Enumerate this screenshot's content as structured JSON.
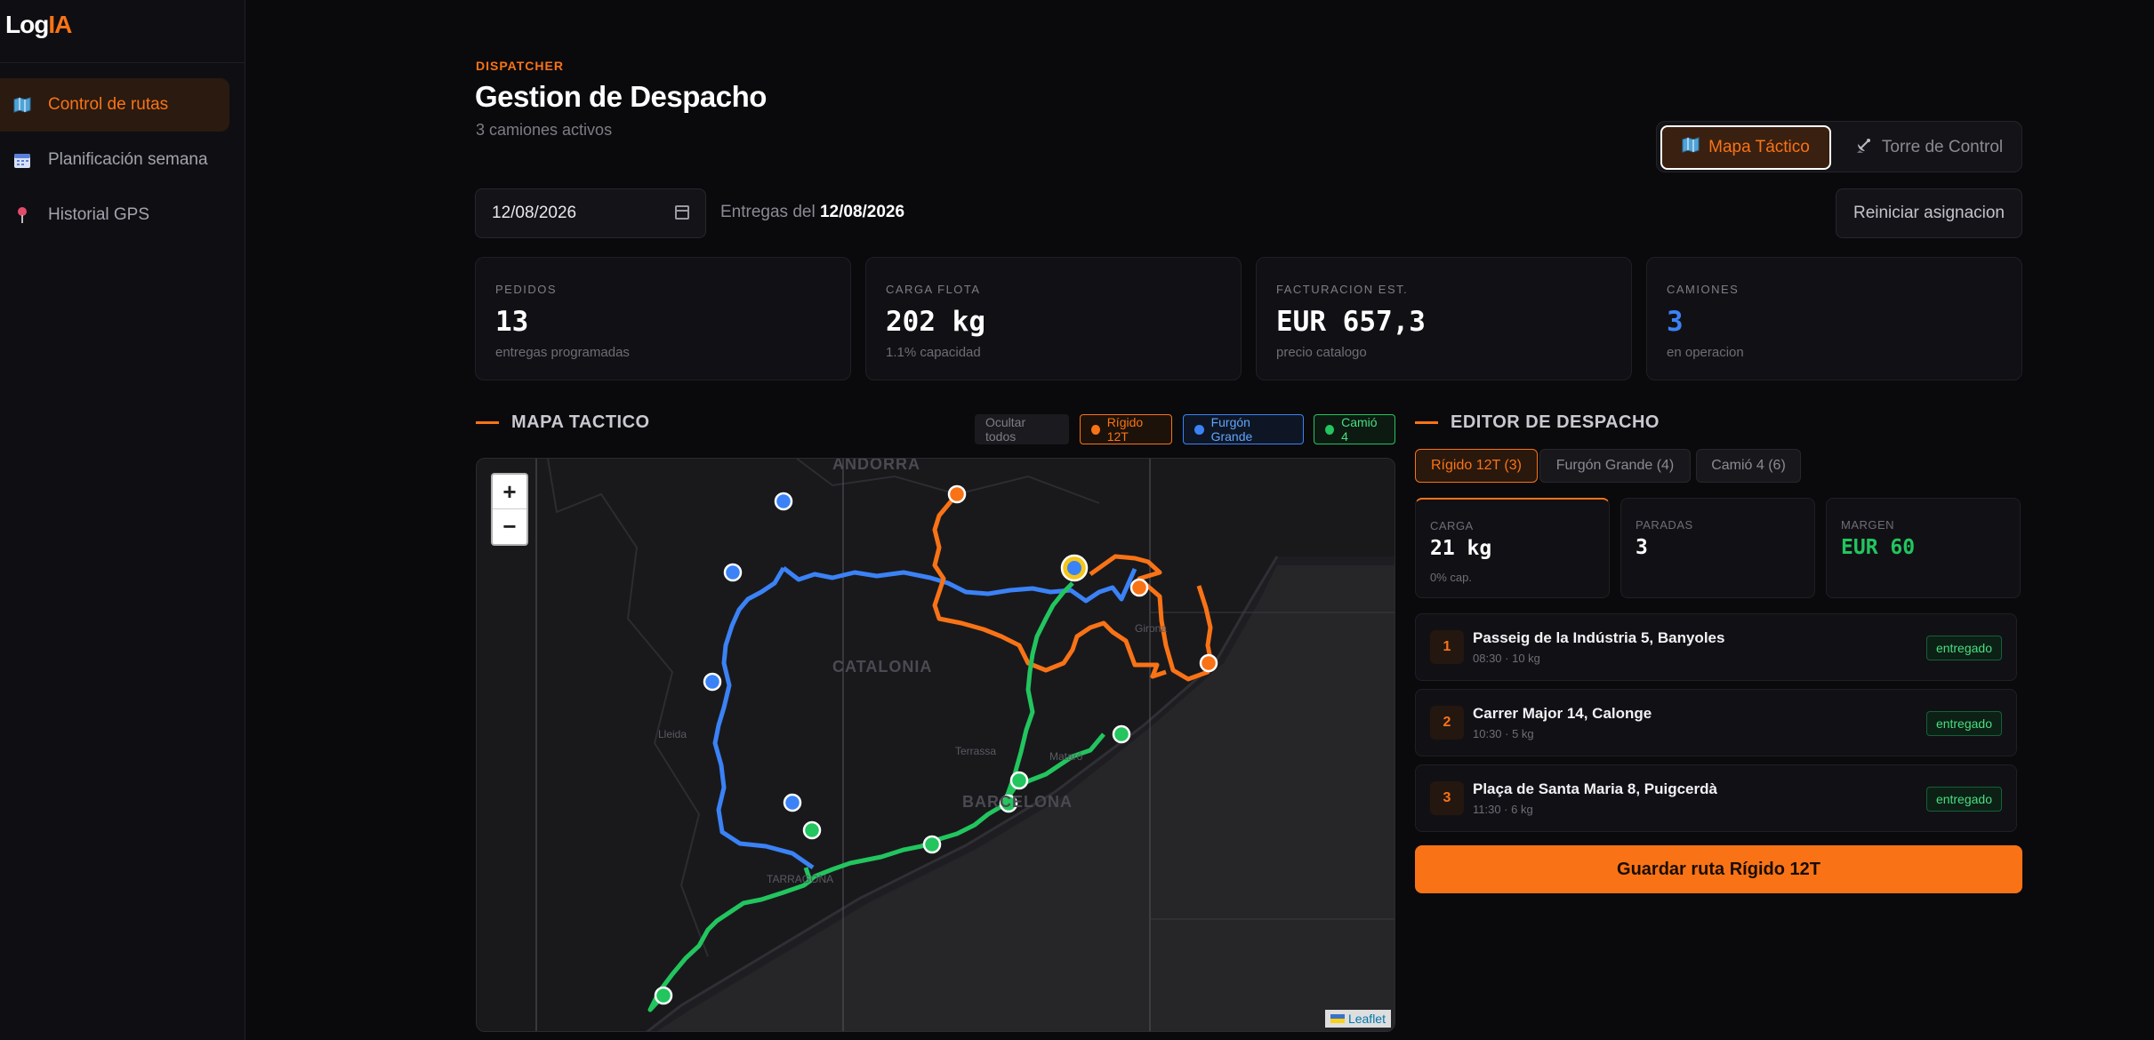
{
  "app": {
    "logo_prefix": "Log",
    "logo_suffix": "IA"
  },
  "sidebar": {
    "items": [
      {
        "label": "Control de rutas",
        "icon": "map-icon",
        "active": true
      },
      {
        "label": "Planificación semana",
        "icon": "calendar-icon",
        "active": false
      },
      {
        "label": "Historial GPS",
        "icon": "pin-icon",
        "active": false
      }
    ]
  },
  "header": {
    "eyebrow": "DISPATCHER",
    "title": "Gestion de Despacho",
    "subtitle": "3 camiones activos"
  },
  "view_toggle": {
    "tactical": "Mapa Táctico",
    "tower": "Torre de Control"
  },
  "date": {
    "value": "12/08/2026",
    "label_prefix": "Entregas del",
    "label_date": "12/08/2026"
  },
  "reset_label": "Reiniciar asignacion",
  "kpis": [
    {
      "label": "PEDIDOS",
      "value": "13",
      "sub": "entregas programadas"
    },
    {
      "label": "CARGA FLOTA",
      "value": "202 kg",
      "sub": "1.1% capacidad"
    },
    {
      "label": "FACTURACION EST.",
      "value": "EUR 657,3",
      "sub": "precio catalogo"
    },
    {
      "label": "CAMIONES",
      "value": "3",
      "sub": "en operacion",
      "value_color": "#3b82f6"
    }
  ],
  "map_section": {
    "title": "MAPA TACTICO",
    "hide_all": "Ocultar todos",
    "legend": [
      {
        "name": "Rígido 12T",
        "color": "#f97316"
      },
      {
        "name": "Furgón Grande",
        "color": "#3b82f6"
      },
      {
        "name": "Camió 4",
        "color": "#22c55e"
      }
    ],
    "places": [
      "ANDORRA",
      "CATALONIA",
      "Lleida",
      "Terrassa",
      "Girona",
      "Mataró",
      "BARCELONA",
      "TARRAGONA"
    ],
    "zoom_in": "+",
    "zoom_out": "−",
    "attribution": "Leaflet"
  },
  "editor": {
    "title": "EDITOR DE DESPACHO",
    "tabs": [
      "Rígido 12T (3)",
      "Furgón Grande (4)",
      "Camió 4 (6)"
    ],
    "stats": [
      {
        "label": "CARGA",
        "value": "21 kg",
        "sub": "0% cap."
      },
      {
        "label": "PARADAS",
        "value": "3",
        "sub": ""
      },
      {
        "label": "MARGEN",
        "value": "EUR 60",
        "sub": "",
        "value_color": "#22c55e"
      }
    ],
    "stops": [
      {
        "num": "1",
        "address": "Passeig de la Indústria 5, Banyoles",
        "meta": "08:30 · 10 kg",
        "status": "entregado"
      },
      {
        "num": "2",
        "address": "Carrer Major 14, Calonge",
        "meta": "10:30 · 5 kg",
        "status": "entregado"
      },
      {
        "num": "3",
        "address": "Plaça de Santa Maria 8, Puigcerdà",
        "meta": "11:30 · 6 kg",
        "status": "entregado"
      }
    ],
    "save_label": "Guardar ruta Rígido 12T"
  }
}
